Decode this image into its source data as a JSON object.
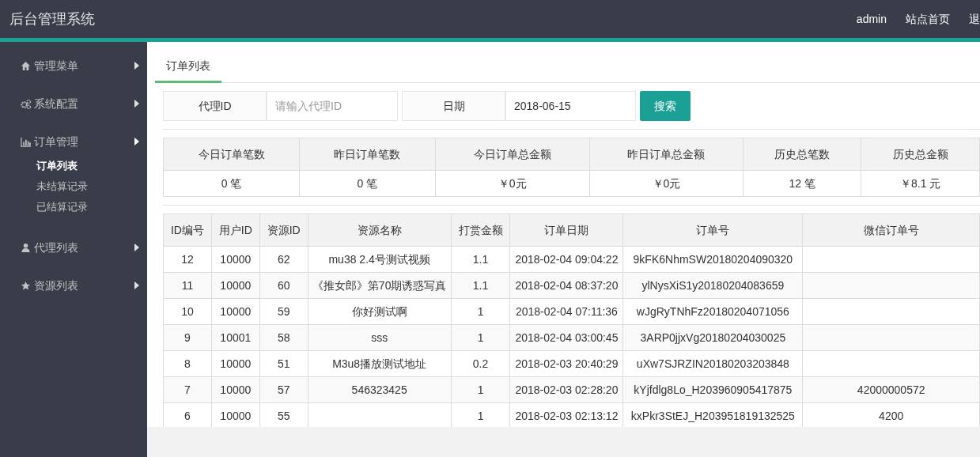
{
  "header": {
    "title": "后台管理系统",
    "links": [
      "admin",
      "站点首页",
      "退"
    ]
  },
  "sidebar": {
    "items": [
      {
        "label": "管理菜单",
        "expanded": false
      },
      {
        "label": "系统配置",
        "expanded": false
      },
      {
        "label": "订单管理",
        "expanded": true,
        "children": [
          {
            "label": "订单列表",
            "selected": true
          },
          {
            "label": "未结算记录",
            "selected": false
          },
          {
            "label": "已结算记录",
            "selected": false
          }
        ]
      },
      {
        "label": "代理列表",
        "expanded": false
      },
      {
        "label": "资源列表",
        "expanded": false
      }
    ]
  },
  "tabs": [
    {
      "label": "订单列表",
      "selected": true
    }
  ],
  "filter": {
    "agent_label": "代理ID",
    "agent_placeholder": "请输入代理ID",
    "date_label": "日期",
    "date_value": "2018-06-15",
    "search_button": "搜索"
  },
  "stats": {
    "columns": [
      "今日订单笔数",
      "昨日订单笔数",
      "今日订单总金额",
      "昨日订单总金额",
      "历史总笔数",
      "历史总金额"
    ],
    "values": [
      "0 笔",
      "0 笔",
      "￥0元",
      "￥0元",
      "12 笔",
      "￥8.1 元"
    ]
  },
  "orders": {
    "columns": [
      "ID编号",
      "用户ID",
      "资源ID",
      "资源名称",
      "打赏金额",
      "订单日期",
      "订单号",
      "微信订单号"
    ],
    "rows": [
      [
        "12",
        "10000",
        "62",
        "mu38 2.4号测试视频",
        "1.1",
        "2018-02-04 09:04:22",
        "9kFK6NhmSW20180204090320",
        ""
      ],
      [
        "11",
        "10000",
        "60",
        "《推女郎》第70期诱惑写真",
        "1.1",
        "2018-02-04 08:37:20",
        "ylNysXiS1y20180204083659",
        ""
      ],
      [
        "10",
        "10000",
        "59",
        "你好测试啊",
        "1",
        "2018-02-04 07:11:36",
        "wJgRyTNhFz20180204071056",
        ""
      ],
      [
        "9",
        "10001",
        "58",
        "sss",
        "1",
        "2018-02-04 03:00:45",
        "3ARP0jjxVg20180204030025",
        ""
      ],
      [
        "8",
        "10000",
        "51",
        "M3u8播放测试地址",
        "0.2",
        "2018-02-03 20:40:29",
        "uXw7SJRZIN20180203203848",
        ""
      ],
      [
        "7",
        "10000",
        "57",
        "546323425",
        "1",
        "2018-02-03 02:28:20",
        "kYjfdlg8Lo_H203960905417875",
        "42000000572"
      ],
      [
        "6",
        "10000",
        "55",
        "",
        "1",
        "2018-02-03 02:13:12",
        "kxPkr3StEJ_H203951819132525",
        "4200"
      ]
    ]
  }
}
